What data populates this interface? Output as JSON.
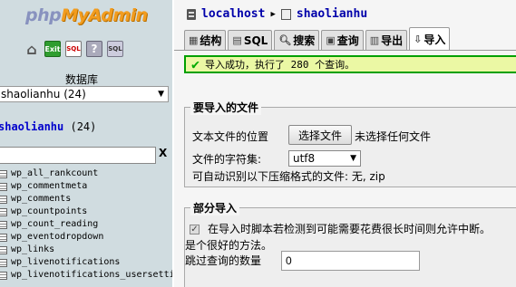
{
  "left": {
    "logo_php": "php",
    "logo_myadmin": "MyAdmin",
    "quick_icons": [
      "home-icon",
      "exit-icon",
      "sql-query-icon",
      "help-icon",
      "sql-docs-icon"
    ],
    "db_label": "数据库",
    "db_selected": "shaolianhu (24)",
    "db_title_name": "shaolianhu",
    "db_title_count": "(24)",
    "filter_value": "",
    "filter_clear": "X",
    "tables": [
      "wp_all_rankcount",
      "wp_commentmeta",
      "wp_comments",
      "wp_countpoints",
      "wp_count_reading",
      "wp_eventodropdown",
      "wp_links",
      "wp_livenotifications",
      "wp_livenotifications_usersettings"
    ]
  },
  "breadcrumb": {
    "server": "localhost",
    "database": "shaolianhu"
  },
  "tabs": [
    {
      "label": "结构",
      "icon": "structure-icon"
    },
    {
      "label": "SQL",
      "icon": "sql-icon"
    },
    {
      "label": "搜索",
      "icon": "search-icon"
    },
    {
      "label": "查询",
      "icon": "query-icon"
    },
    {
      "label": "导出",
      "icon": "export-icon"
    },
    {
      "label": "导入",
      "icon": "import-icon",
      "active": true
    }
  ],
  "success_message": "导入成功，执行了 280 个查询。",
  "file_section": {
    "legend": "要导入的文件",
    "file_label": "文本文件的位置",
    "choose_button": "选择文件",
    "no_file": "未选择任何文件",
    "charset_label": "文件的字符集:",
    "charset_value": "utf8",
    "compression_note": "可自动识别以下压缩格式的文件: 无, zip"
  },
  "partial_section": {
    "legend": "部分导入",
    "interrupt_label": "在导入时脚本若检测到可能需要花费很长时间则允许中断。",
    "interrupt_label_cont": "是个很好的方法。",
    "interrupt_checked": true,
    "skip_label": "跳过查询的数量",
    "skip_value": "0"
  },
  "colors": {
    "left_bg": "#d0dce0",
    "right_bg": "#f5f5f5",
    "success_border": "#00a000",
    "success_bg": "#ebf8a4",
    "link": "#0000aa"
  }
}
